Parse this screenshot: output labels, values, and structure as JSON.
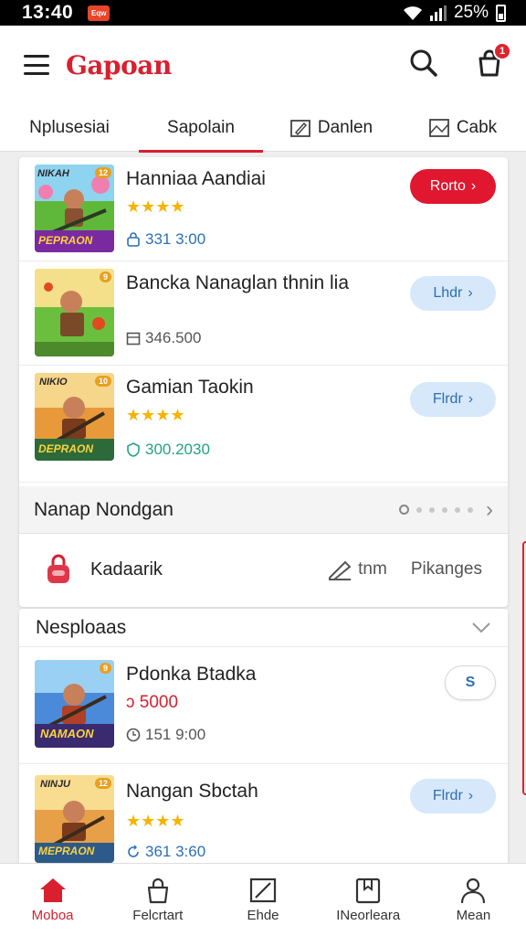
{
  "status_bar": {
    "time": "13:40",
    "app_badge": "Eqw",
    "battery": "25%"
  },
  "header": {
    "brand": "Gapoan",
    "cart_count": "1"
  },
  "tabs": [
    {
      "label": "Nplusesiai"
    },
    {
      "label": "Sapolain"
    },
    {
      "label": "Danlen"
    },
    {
      "label": "Cabk"
    }
  ],
  "games": [
    {
      "title": "Hanniaa Aandiai",
      "stars": "★★★★",
      "meta": "331 3:00",
      "button": "Rorto",
      "thumb_top": "NIKAH",
      "thumb_bottom": "PEPRAON",
      "thumb_badge": "12"
    },
    {
      "title": "Bancka Nanaglan thnin lia",
      "meta": "346.500",
      "button": "Lhdr",
      "thumb_badge": "9"
    },
    {
      "title": "Gamian Taokin",
      "stars": "★★★★",
      "meta": "300.2030",
      "button": "Flrdr",
      "thumb_top": "NIKIO",
      "thumb_bottom": "DEPRAON",
      "thumb_badge": "10"
    }
  ],
  "section": {
    "title": "Nanap Nondgan"
  },
  "link_row": {
    "label": "Kadaarik",
    "item1": "tnm",
    "item2": "Pikanges"
  },
  "new_section": {
    "title": "Nesploaas"
  },
  "new_games": [
    {
      "title": "Pdonka Btadka",
      "price": "ↄ 5000",
      "meta": "151 9:00",
      "button": "S",
      "thumb_bottom": "NAMAON",
      "thumb_badge": "9"
    },
    {
      "title": "Nangan Sbctah",
      "stars": "★★★★",
      "meta": "361 3:60",
      "button": "Flrdr",
      "thumb_top": "NINJU",
      "thumb_bottom": "MEPRAON",
      "thumb_badge": "12"
    }
  ],
  "bottom_nav": [
    {
      "label": "Moboa"
    },
    {
      "label": "Felcrtart"
    },
    {
      "label": "Ehde"
    },
    {
      "label": "INeorleara"
    },
    {
      "label": "Mean"
    }
  ],
  "colors": {
    "brand_red": "#d8202f",
    "button_blue_bg": "#d6e8fa",
    "star": "#f5b400"
  }
}
